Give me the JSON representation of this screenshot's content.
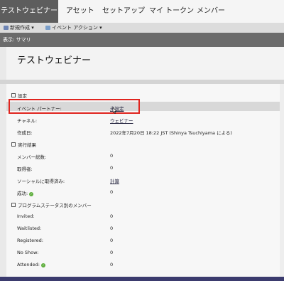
{
  "tabs": [
    {
      "label": "テストウェビナー",
      "active": true
    },
    {
      "label": "アセット",
      "active": false
    },
    {
      "label": "セットアップ",
      "active": false
    },
    {
      "label": "マイ トークン",
      "active": false
    },
    {
      "label": "メンバー",
      "active": false
    }
  ],
  "toolbar": {
    "new_label": "新規作成",
    "event_actions_label": "イベント アクション"
  },
  "view_bar": {
    "label": "表示: サマリ"
  },
  "page_title": "テストウェビナー",
  "sections": {
    "settings": {
      "heading": "設定",
      "rows": [
        {
          "label": "イベント パートナー:",
          "value": "未設定"
        },
        {
          "label": "チャネル:",
          "value": "ウェビナー"
        },
        {
          "label": "作成日:",
          "value": "2022年7月20日 18:22 JST (Shinya Tsuchiyama による)"
        }
      ]
    },
    "results": {
      "heading": "実行結果",
      "rows": [
        {
          "label": "メンバー総数:",
          "value": "0"
        },
        {
          "label": "取得者:",
          "value": "0"
        },
        {
          "label": "ソーシャルに取得済み:",
          "value": "計算"
        },
        {
          "label": "成功:",
          "value": "0"
        }
      ]
    },
    "program_status": {
      "heading": "プログラムステータス別のメンバー",
      "rows": [
        {
          "label": "Invited:",
          "value": "0"
        },
        {
          "label": "Waitlisted:",
          "value": "0"
        },
        {
          "label": "Registered:",
          "value": "0"
        },
        {
          "label": "No Show:",
          "value": "0"
        },
        {
          "label": "Attended:",
          "value": "0"
        }
      ]
    }
  },
  "colors": {
    "highlight_border": "#e0251f",
    "success_check": "#5fae3e",
    "active_tab": "#5d5d5d"
  }
}
